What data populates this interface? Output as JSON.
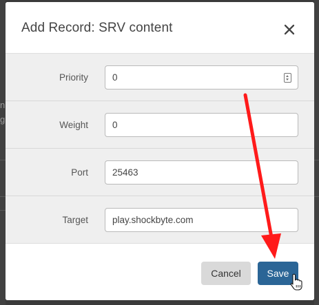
{
  "dialog": {
    "title": "Add Record: SRV content",
    "close_icon": "close-icon"
  },
  "form": {
    "fields": [
      {
        "label": "Priority",
        "value": "0",
        "has_spinner": true
      },
      {
        "label": "Weight",
        "value": "0"
      },
      {
        "label": "Port",
        "value": "25463"
      },
      {
        "label": "Target",
        "value": "play.shockbyte.com"
      }
    ]
  },
  "footer": {
    "cancel_label": "Cancel",
    "save_label": "Save"
  },
  "annotation": {
    "arrow_color": "#ff1a1a",
    "cursor_icon": "hand-pointer-icon"
  },
  "colors": {
    "primary_button": "#2b6596",
    "secondary_button": "#d9d9d9"
  }
}
